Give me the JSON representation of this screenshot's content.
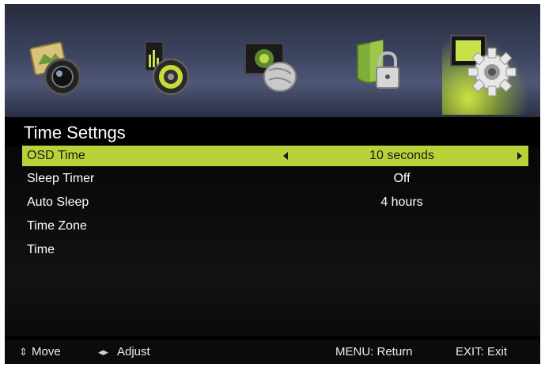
{
  "header": {
    "tabs": [
      {
        "icon": "picture-icon",
        "active": false
      },
      {
        "icon": "sound-icon",
        "active": false
      },
      {
        "icon": "channel-icon",
        "active": false
      },
      {
        "icon": "lock-icon",
        "active": false
      },
      {
        "icon": "setup-gear-icon",
        "active": true
      }
    ]
  },
  "menu": {
    "title": "Time Settngs",
    "items": [
      {
        "label": "OSD Time",
        "value": "10 seconds",
        "selected": true
      },
      {
        "label": "Sleep Timer",
        "value": "Off",
        "selected": false
      },
      {
        "label": "Auto Sleep",
        "value": "4 hours",
        "selected": false
      },
      {
        "label": "Time Zone",
        "value": "",
        "selected": false
      },
      {
        "label": "Time",
        "value": "",
        "selected": false
      }
    ]
  },
  "footer": {
    "move_glyph": "⇕",
    "move_label": "Move",
    "adjust_glyph": "◂▸",
    "adjust_label": "Adjust",
    "menu_label": "MENU: Return",
    "exit_label": "EXIT: Exit"
  },
  "colors": {
    "highlight": "#b8d33a",
    "background": "#000000",
    "tabbar": "#3d4460"
  }
}
